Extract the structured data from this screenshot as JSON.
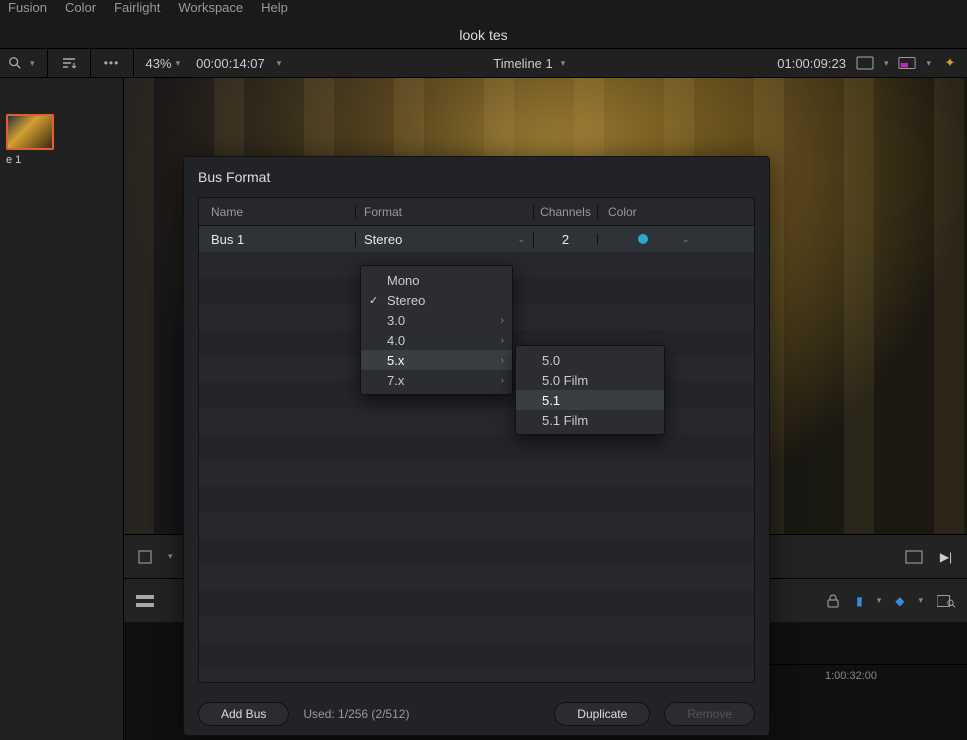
{
  "menu": {
    "fusion": "Fusion",
    "color": "Color",
    "fairlight": "Fairlight",
    "workspace": "Workspace",
    "help": "Help"
  },
  "project_name": "look tes",
  "toolbar": {
    "zoom": "43%",
    "source_tc": "00:00:14:07",
    "timeline_name": "Timeline 1",
    "record_tc": "01:00:09:23"
  },
  "clip_name": "e 1",
  "ruler_label": "1:00:32:00",
  "modal": {
    "title": "Bus Format",
    "headers": {
      "name": "Name",
      "format": "Format",
      "channels": "Channels",
      "color": "Color"
    },
    "row": {
      "name": "Bus 1",
      "format": "Stereo",
      "channels": "2",
      "color": "#2aa8c9"
    },
    "add": "Add Bus",
    "used": "Used: 1/256  (2/512)",
    "dup": "Duplicate",
    "remove": "Remove"
  },
  "format_menu": [
    "Mono",
    "Stereo",
    "3.0",
    "4.0",
    "5.x",
    "7.x"
  ],
  "format_menu_selected": "Stereo",
  "format_menu_hover": "5.x",
  "submenu_5x": [
    "5.0",
    "5.0 Film",
    "5.1",
    "5.1 Film"
  ],
  "submenu_5x_hover": "5.1"
}
